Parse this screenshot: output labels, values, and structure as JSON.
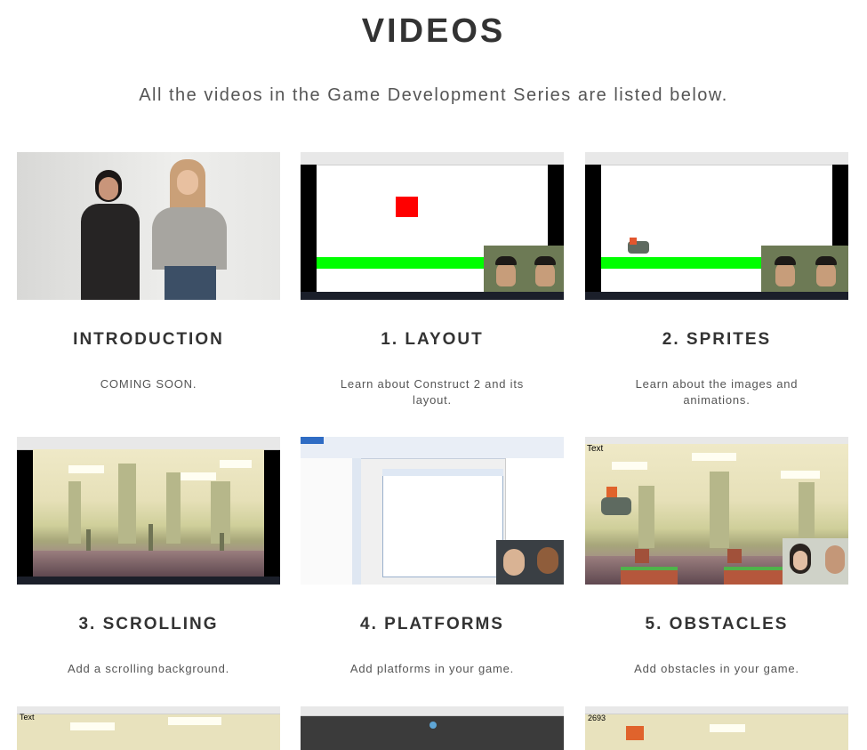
{
  "header": {
    "title": "VIDEOS",
    "subtitle": "All the videos in the Game Development Series are listed below."
  },
  "videos": [
    {
      "title": "INTRODUCTION",
      "description": "COMING SOON."
    },
    {
      "title": "1. LAYOUT",
      "description": "Learn about Construct 2 and its layout."
    },
    {
      "title": "2. SPRITES",
      "description": "Learn about the images and animations."
    },
    {
      "title": "3. SCROLLING",
      "description": "Add a scrolling background."
    },
    {
      "title": "4. PLATFORMS",
      "description": "Add platforms in your game."
    },
    {
      "title": "5. OBSTACLES",
      "description": "Add obstacles in your game."
    }
  ],
  "thumb_overlay": {
    "obstacles_text": "Text",
    "row3_left_text": "Text",
    "row3_right_score": "2693"
  },
  "colors": {
    "green_platform": "#00ff00",
    "red_block": "#ff0000",
    "heading": "#333333"
  }
}
